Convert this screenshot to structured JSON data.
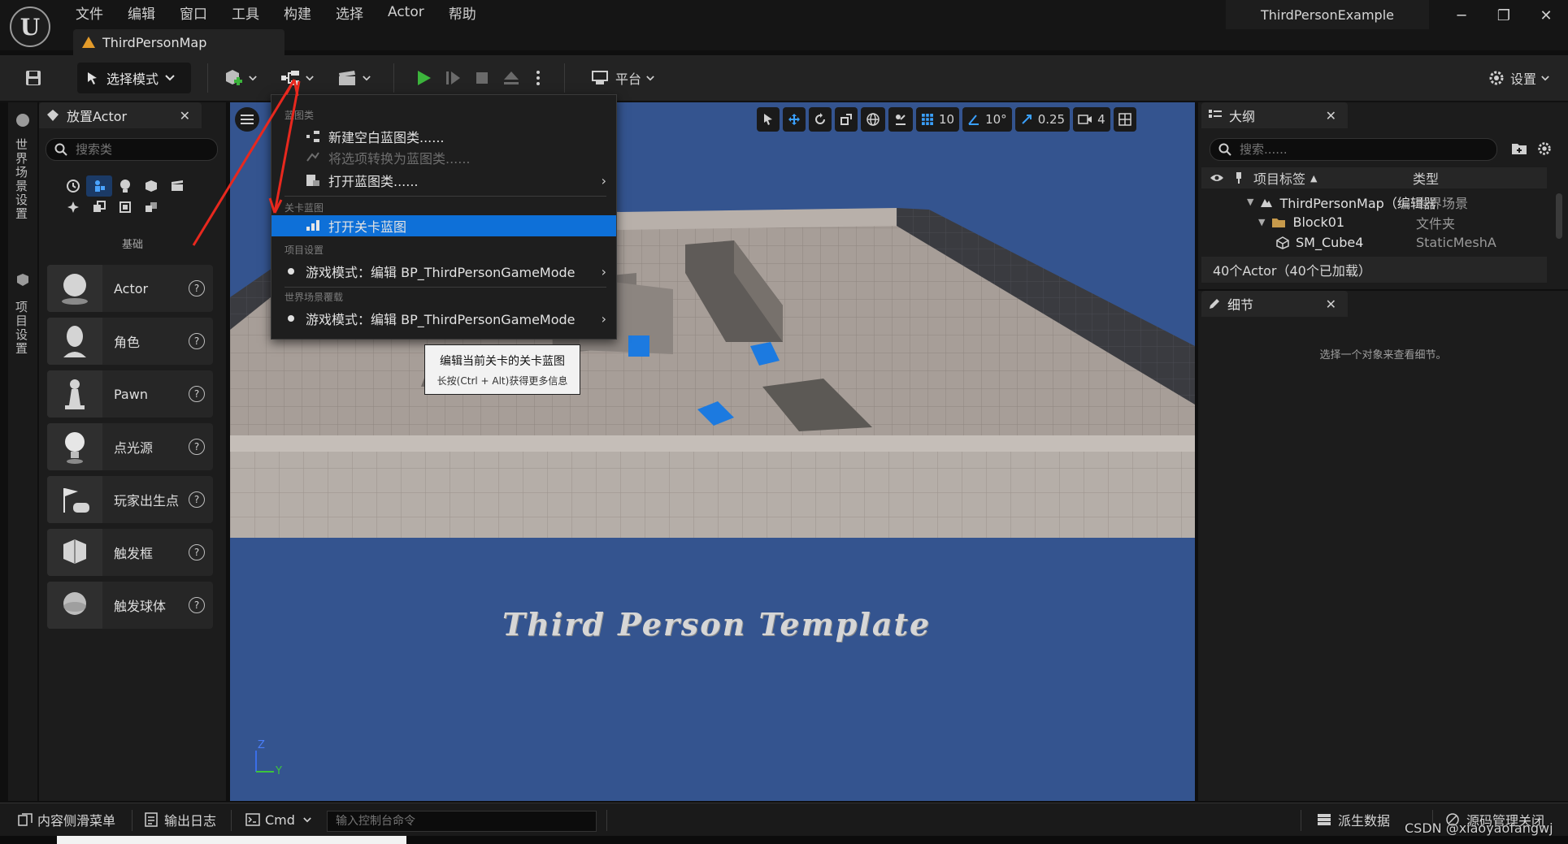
{
  "menu": [
    "文件",
    "编辑",
    "窗口",
    "工具",
    "构建",
    "选择",
    "Actor",
    "帮助"
  ],
  "map_tab": "ThirdPersonMap",
  "project_name": "ThirdPersonExample",
  "toolbar": {
    "mode": "选择模式",
    "platform": "平台",
    "settings": "设置"
  },
  "left_strip": {
    "world_settings": "世界场景设置",
    "project_settings": "项目设置"
  },
  "place_actors": {
    "title": "放置Actor",
    "search_placeholder": "搜索类",
    "category_label": "基础",
    "items": [
      {
        "label": "Actor"
      },
      {
        "label": "角色"
      },
      {
        "label": "Pawn"
      },
      {
        "label": "点光源"
      },
      {
        "label": "玩家出生点"
      },
      {
        "label": "触发框"
      },
      {
        "label": "触发球体"
      }
    ]
  },
  "viewport": {
    "grid_snap": "10",
    "rotation_snap": "10°",
    "scale_snap": "0.25",
    "camera_speed": "4",
    "template_text": "Third Person Template",
    "axis_z": "Z",
    "axis_y": "Y"
  },
  "dropdown": {
    "section_blueprint_class": "蓝图类",
    "new_empty_blueprint": "新建空白蓝图类......",
    "convert_to_blueprint": "将选项转换为蓝图类......",
    "open_blueprint_class": "打开蓝图类......",
    "section_level_blueprint": "关卡蓝图",
    "open_level_blueprint": "打开关卡蓝图",
    "section_project_settings": "项目设置",
    "game_mode_project": "游戏模式：编辑 BP_ThirdPersonGameMode",
    "section_world_override": "世界场景覆载",
    "game_mode_world": "游戏模式：编辑 BP_ThirdPersonGameMode"
  },
  "tooltip": {
    "title": "编辑当前关卡的关卡蓝图",
    "hint": "长按(Ctrl + Alt)获得更多信息"
  },
  "outliner": {
    "title": "大纲",
    "search_placeholder": "搜索......",
    "col_label": "项目标签",
    "col_type": "类型",
    "rows": [
      {
        "name": "ThirdPersonMap（编辑器",
        "type": "世界场景"
      },
      {
        "name": "Block01",
        "type": "文件夹"
      },
      {
        "name": "SM_Cube4",
        "type": "StaticMeshA"
      }
    ],
    "count": "40个Actor（40个已加载）"
  },
  "details": {
    "title": "细节",
    "empty_text": "选择一个对象来查看细节。"
  },
  "statusbar": {
    "content_drawer": "内容侧滑菜单",
    "output_log": "输出日志",
    "cmd": "Cmd",
    "console_placeholder": "输入控制台命令",
    "derived_data": "派生数据",
    "source_control": "源码管理关闭"
  },
  "watermark": "CSDN @xiaoyaofangwj",
  "colors": {
    "accent": "#0e70d8",
    "viewport_bg": "#34548f",
    "cube": "#1c7ae0",
    "play": "#3cb43c",
    "annotation": "#e8281e"
  }
}
